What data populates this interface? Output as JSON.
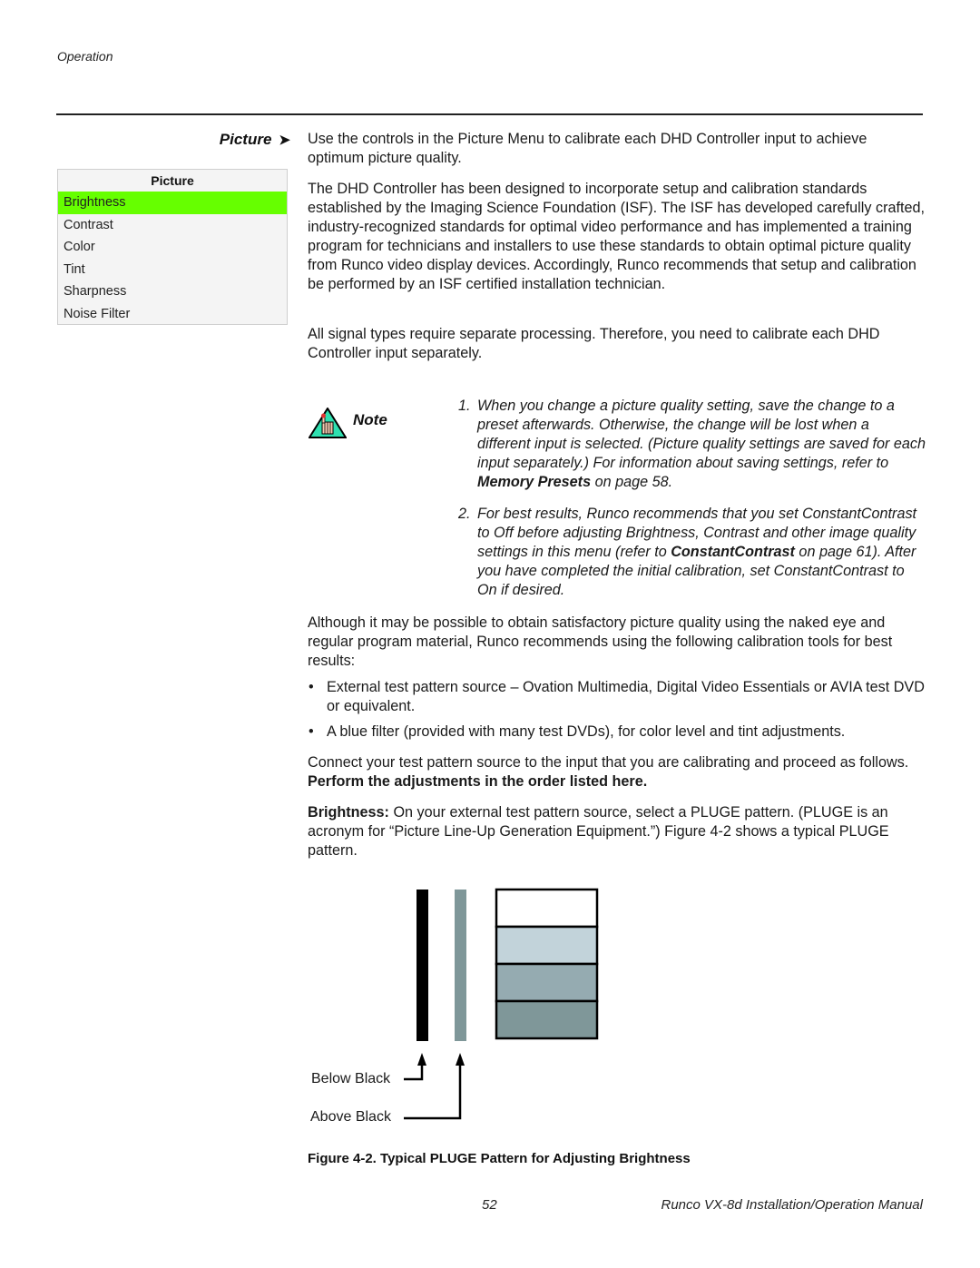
{
  "header": {
    "running_head": "Operation"
  },
  "section": {
    "side_heading": "Picture",
    "side_heading_arrow": "➤"
  },
  "menu": {
    "title": "Picture",
    "selected_index": 0,
    "highlight_color": "#66ff00",
    "items": [
      {
        "label": "Brightness"
      },
      {
        "label": "Contrast"
      },
      {
        "label": "Color"
      },
      {
        "label": "Tint"
      },
      {
        "label": "Sharpness"
      },
      {
        "label": "Noise Filter"
      }
    ]
  },
  "body": {
    "para1": "Use the controls in the Picture Menu to calibrate each DHD Controller input to achieve optimum picture quality.",
    "para2": "The DHD Controller has been designed to incorporate setup and calibration standards established by the Imaging Science Foundation (ISF). The ISF has developed carefully crafted, industry-recognized standards for optimal video performance and has implemented a training program for technicians and installers to use these standards to obtain optimal picture quality from Runco video display devices. Accordingly, Runco recommends that setup and calibration be performed by an ISF certified installation technician.",
    "para3": "All signal types require separate processing. Therefore, you need to calibrate each DHD Controller input separately.",
    "para4": "Although it may be possible to obtain satisfactory picture quality using the naked eye and regular program material, Runco recommends using the following calibration tools for best results:",
    "bullets": [
      {
        "text": "External test pattern source – Ovation Multimedia, Digital Video Essentials or AVIA test DVD or equivalent."
      },
      {
        "text": "A blue filter (provided with many test DVDs), for color level and tint adjustments."
      }
    ],
    "bullet_glyph": "•",
    "para5_start": "Connect your test pattern source to the input that you are calibrating and proceed as follows. ",
    "para5_bold": "Perform the adjustments in the order listed here.",
    "para6_bold": "Brightness:",
    "para6_rest": " On your external test pattern source, select a PLUGE pattern. (PLUGE is an acronym for “Picture Line-Up Generation Equipment.”) Figure 4-2 shows a typical PLUGE pattern."
  },
  "note": {
    "label": "Note",
    "icon": "warning-hand-icon",
    "items": [
      {
        "num": "1.",
        "text_before": "When you change a picture quality setting, save the change to a preset afterwards. Otherwise, the change will be lost when a different input is selected. (Picture quality settings are saved for each input separately.) For information about saving settings, refer to ",
        "bold": "Memory Presets",
        "text_after": " on page 58."
      },
      {
        "num": "2.",
        "text_before": "For best results, Runco recommends that you set ConstantContrast to Off before adjusting Brightness, Contrast and other image quality settings in this menu (refer to ",
        "bold": "ConstantContrast",
        "text_after": " on page 61). After you have completed the initial calibration, set ConstantContrast to On if desired."
      }
    ]
  },
  "figure": {
    "below_black_label": "Below Black",
    "above_black_label": "Above Black",
    "bars": [
      {
        "name": "below-black-bar",
        "color": "#000000"
      },
      {
        "name": "above-black-bar",
        "color": "#7f9799"
      }
    ],
    "steps": [
      {
        "color": "#ffffff"
      },
      {
        "color": "#c2d3da"
      },
      {
        "color": "#95abb1"
      },
      {
        "color": "#7f9799"
      }
    ],
    "caption": "Figure 4-2. Typical PLUGE Pattern for Adjusting Brightness"
  },
  "footer": {
    "page_number": "52",
    "manual_title": "Runco VX-8d Installation/Operation Manual"
  }
}
